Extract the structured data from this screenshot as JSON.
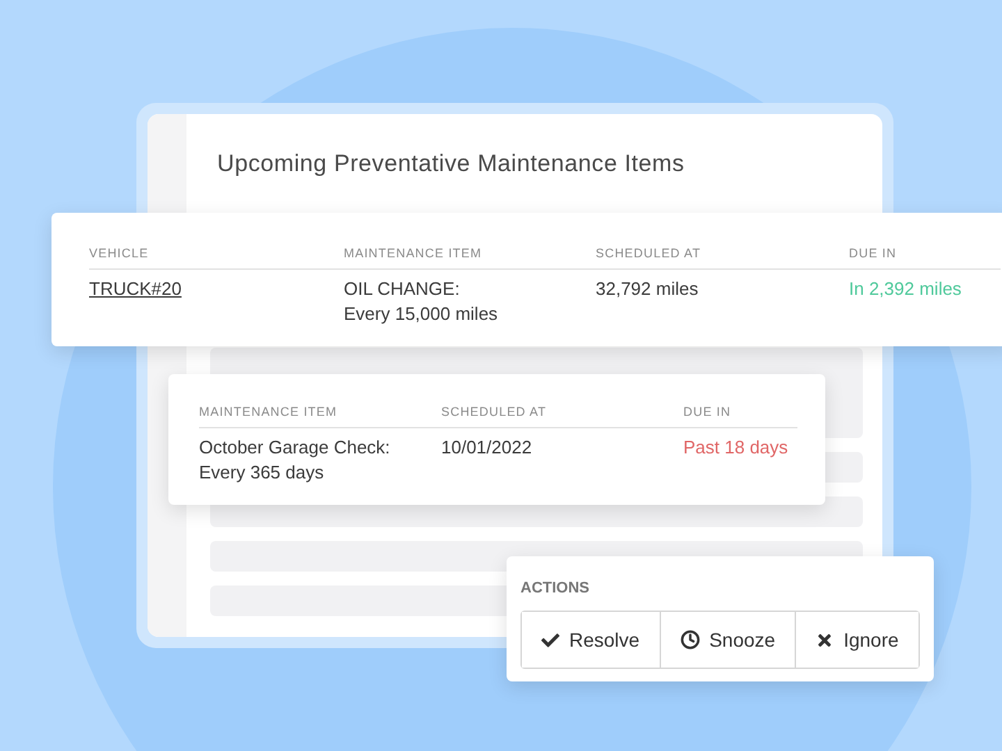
{
  "panel": {
    "title": "Upcoming Preventative Maintenance Items"
  },
  "vehicle_table": {
    "columns": [
      "VEHICLE",
      "MAINTENANCE ITEM",
      "SCHEDULED AT",
      "DUE IN"
    ],
    "rows": [
      {
        "vehicle": "TRUCK#20",
        "item": "OIL CHANGE:\nEvery 15,000 miles",
        "scheduled": "32,792 miles",
        "due": "In 2,392 miles",
        "color": "#4fc99b"
      }
    ]
  },
  "item_table": {
    "columns": [
      "MAINTENANCE ITEM",
      "SCHEDULED AT",
      "DUE IN"
    ],
    "rows": [
      {
        "item": "October Garage Check:\nEvery 365 days",
        "scheduled": "10/01/2022",
        "due": "Past 18 days",
        "color": "#e06666"
      }
    ]
  },
  "actions": {
    "title": "ACTIONS",
    "buttons": [
      {
        "label": "Resolve",
        "kind": "check"
      },
      {
        "label": "Snooze",
        "kind": "clock"
      },
      {
        "label": "Ignore",
        "kind": "cross"
      }
    ]
  }
}
